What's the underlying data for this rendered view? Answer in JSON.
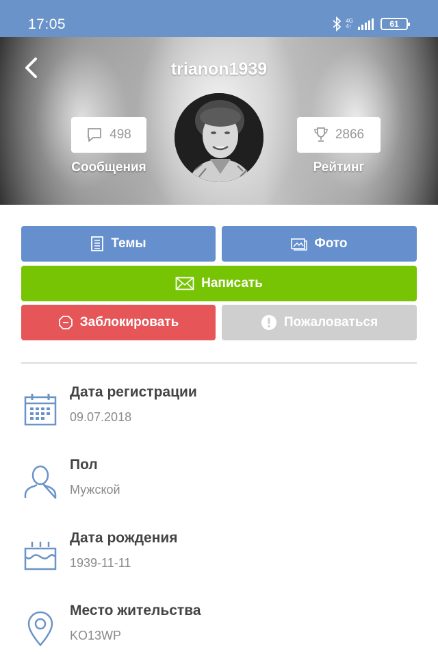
{
  "status_bar": {
    "time": "17:05",
    "network_type": "4G",
    "network_sub": "4↑",
    "battery": "61",
    "icons": [
      "bluetooth-icon",
      "signal-icon",
      "battery-icon"
    ]
  },
  "header": {
    "back_icon": "chevron-left-icon",
    "username": "trianon1939",
    "messages": {
      "icon": "speech-bubble-icon",
      "count": "498",
      "label": "Сообщения"
    },
    "rating": {
      "icon": "trophy-icon",
      "count": "2866",
      "label": "Рейтинг"
    },
    "avatar_alt": "user avatar"
  },
  "actions": {
    "topics": {
      "icon": "document-icon",
      "label": "Темы"
    },
    "photo": {
      "icon": "image-icon",
      "label": "Фото"
    },
    "write": {
      "icon": "envelope-icon",
      "label": "Написать"
    },
    "block": {
      "icon": "octagon-block-icon",
      "label": "Заблокировать"
    },
    "report": {
      "icon": "exclamation-circle-icon",
      "label": "Пожаловаться"
    }
  },
  "info": [
    {
      "icon": "calendar-icon",
      "title": "Дата регистрации",
      "value": "09.07.2018"
    },
    {
      "icon": "user-icon",
      "title": "Пол",
      "value": "Мужской"
    },
    {
      "icon": "cake-icon",
      "title": "Дата рождения",
      "value": "1939-11-11"
    },
    {
      "icon": "location-pin-icon",
      "title": "Место жительства",
      "value": "KO13WP"
    }
  ],
  "colors": {
    "status_bar": "#6a93c9",
    "primary_button": "#6590cd",
    "write_button": "#76c403",
    "block_button": "#e65557",
    "report_button": "#cfcfcf",
    "icon_blue": "#6a93c9"
  }
}
